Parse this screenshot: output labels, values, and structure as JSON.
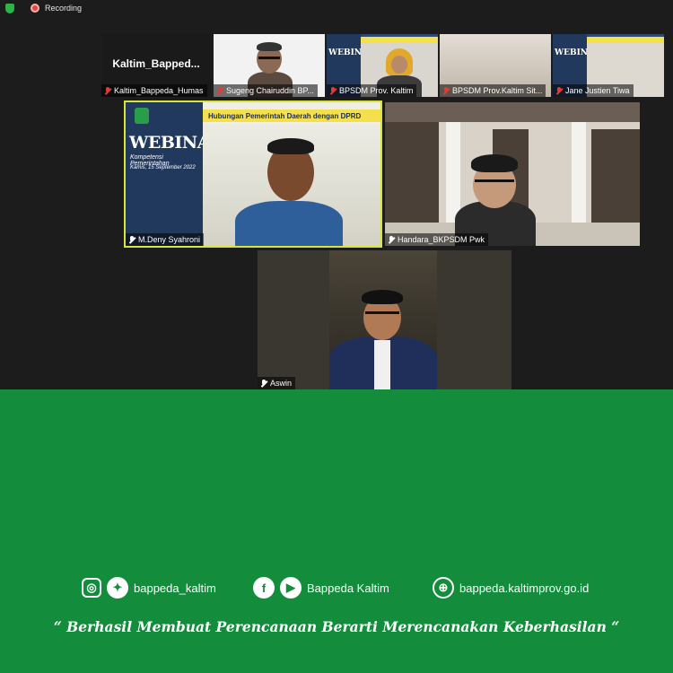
{
  "status_bar": {
    "recording_label": "Recording"
  },
  "participants": {
    "p1": {
      "display_text": "Kaltim_Bapped...",
      "name": "Kaltim_Bappeda_Humas"
    },
    "p2": {
      "name": "Sugeng Chairuddin BP..."
    },
    "p3": {
      "name": "BPSDM Prov. Kaltim"
    },
    "p4": {
      "name": "BPSDM Prov.Kaltim Sit..."
    },
    "p5": {
      "name": "Jane Justien Tiwa"
    },
    "p6": {
      "name": "M.Deny Syahroni"
    },
    "p7": {
      "name": "Handara_BKPSDM Pwk"
    },
    "p8": {
      "name": "Aswin"
    }
  },
  "slide": {
    "banner": "Hubungan Pemerintah Daerah dengan DPRD",
    "title": "WEBINAR",
    "subtitle": "Kompetensi Pemerintahan",
    "date": "Kamis, 15 September 2022",
    "mini_title": "WEBINAR"
  },
  "footer": {
    "instagram_twitter_handle": "bappeda_kaltim",
    "facebook_youtube_name": "Bappeda Kaltim",
    "website": "bappeda.kaltimprov.go.id",
    "tagline": "“ Berhasil  Membuat Perencanaan Berarti Merencanakan Keberhasilan “"
  },
  "colors": {
    "footer_green": "#138d3c",
    "active_speaker_border": "#d9e33a",
    "muted_mic": "#e03c31"
  }
}
